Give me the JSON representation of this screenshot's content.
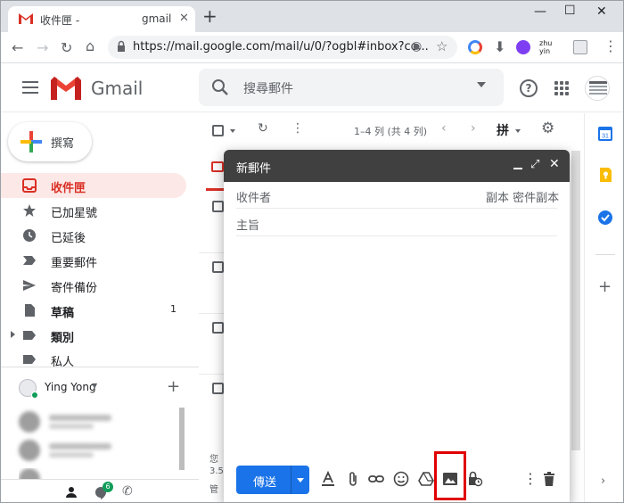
{
  "browser": {
    "tab_title": "收件匣 -",
    "tab_title_tail": "gmail",
    "url": "https://mail.google.com/mail/u/0/?ogbl#inbox?co...",
    "ext_zhuyin": "zhu yin"
  },
  "header": {
    "app_name": "Gmail",
    "search_placeholder": "搜尋郵件"
  },
  "sidebar": {
    "compose_label": "撰寫",
    "items": [
      {
        "label": "收件匣",
        "icon": "inbox-icon",
        "active": true
      },
      {
        "label": "已加星號",
        "icon": "star-icon"
      },
      {
        "label": "已延後",
        "icon": "clock-icon"
      },
      {
        "label": "重要郵件",
        "icon": "important-icon"
      },
      {
        "label": "寄件備份",
        "icon": "send-icon"
      },
      {
        "label": "草稿",
        "icon": "draft-icon",
        "count": "1"
      },
      {
        "label": "類別",
        "icon": "label-icon"
      },
      {
        "label": "私人",
        "icon": "label-icon"
      }
    ],
    "hangouts_user": "Ying Yong",
    "hangouts_badge": "6"
  },
  "list_toolbar": {
    "page_info": "1–4 列 (共 4 列)",
    "input_tool": "拼"
  },
  "footer": {
    "line1": "您",
    "line2": "3.5",
    "line3": "管"
  },
  "compose": {
    "title": "新郵件",
    "to_placeholder": "收件者",
    "cc_bcc": "副本 密件副本",
    "subject_placeholder": "主旨",
    "send_label": "傳送"
  },
  "colors": {
    "accent_red": "#d93025",
    "send_blue": "#1a73e8",
    "highlight": "#e00000",
    "compose_header": "#404040"
  }
}
